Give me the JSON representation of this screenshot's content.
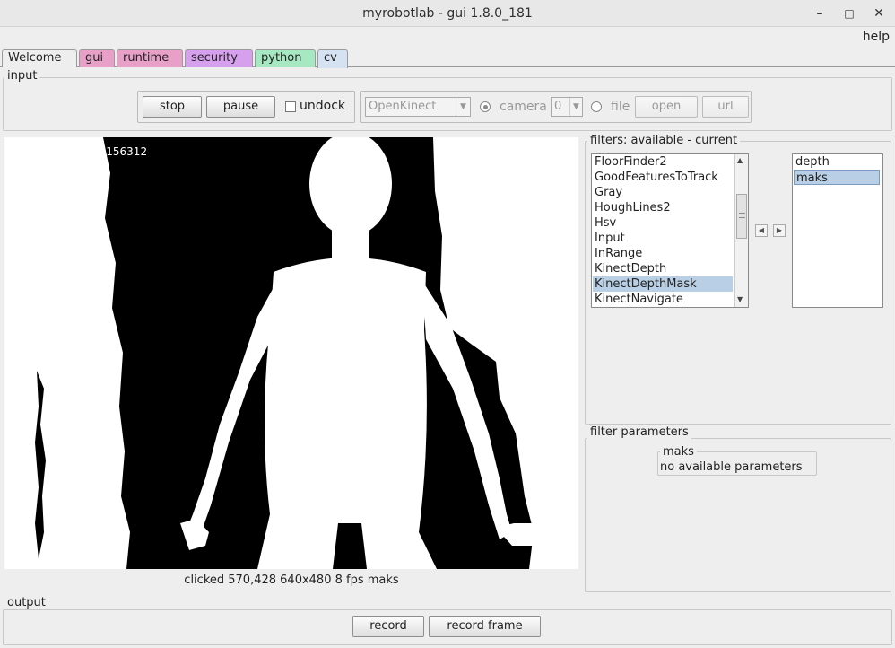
{
  "window": {
    "title": "myrobotlab - gui 1.8.0_181"
  },
  "menu": {
    "help": "help"
  },
  "tabs": [
    {
      "label": "Welcome",
      "color": "#eeeeee"
    },
    {
      "label": "gui",
      "color": "#e8a0c8"
    },
    {
      "label": "runtime",
      "color": "#e8a0c8"
    },
    {
      "label": "security",
      "color": "#d7a0ee"
    },
    {
      "label": "python",
      "color": "#a6e8c2"
    },
    {
      "label": "cv",
      "color": "#d4e2f2"
    }
  ],
  "input": {
    "label": "input",
    "stop": "stop",
    "pause": "pause",
    "undock": "undock",
    "grabber": "OpenKinect",
    "camera_label": "camera",
    "camera_index": "0",
    "file_label": "file",
    "open": "open",
    "url": "url"
  },
  "video": {
    "overlay_text": "14156312"
  },
  "status": "clicked 570,428 640x480 8 fps maks",
  "filters": {
    "label": "filters: available - current",
    "available": [
      "FloorFinder2",
      "GoodFeaturesToTrack",
      "Gray",
      "HoughLines2",
      "Hsv",
      "Input",
      "InRange",
      "KinectDepth",
      "KinectDepthMask",
      "KinectNavigate"
    ],
    "selected_available": "KinectDepthMask",
    "current": [
      "depth",
      "maks"
    ],
    "selected_current": "maks"
  },
  "params": {
    "label": "filter parameters",
    "filter_name": "maks",
    "message": "no available parameters"
  },
  "output": {
    "label": "output",
    "record": "record",
    "record_frame": "record frame"
  }
}
